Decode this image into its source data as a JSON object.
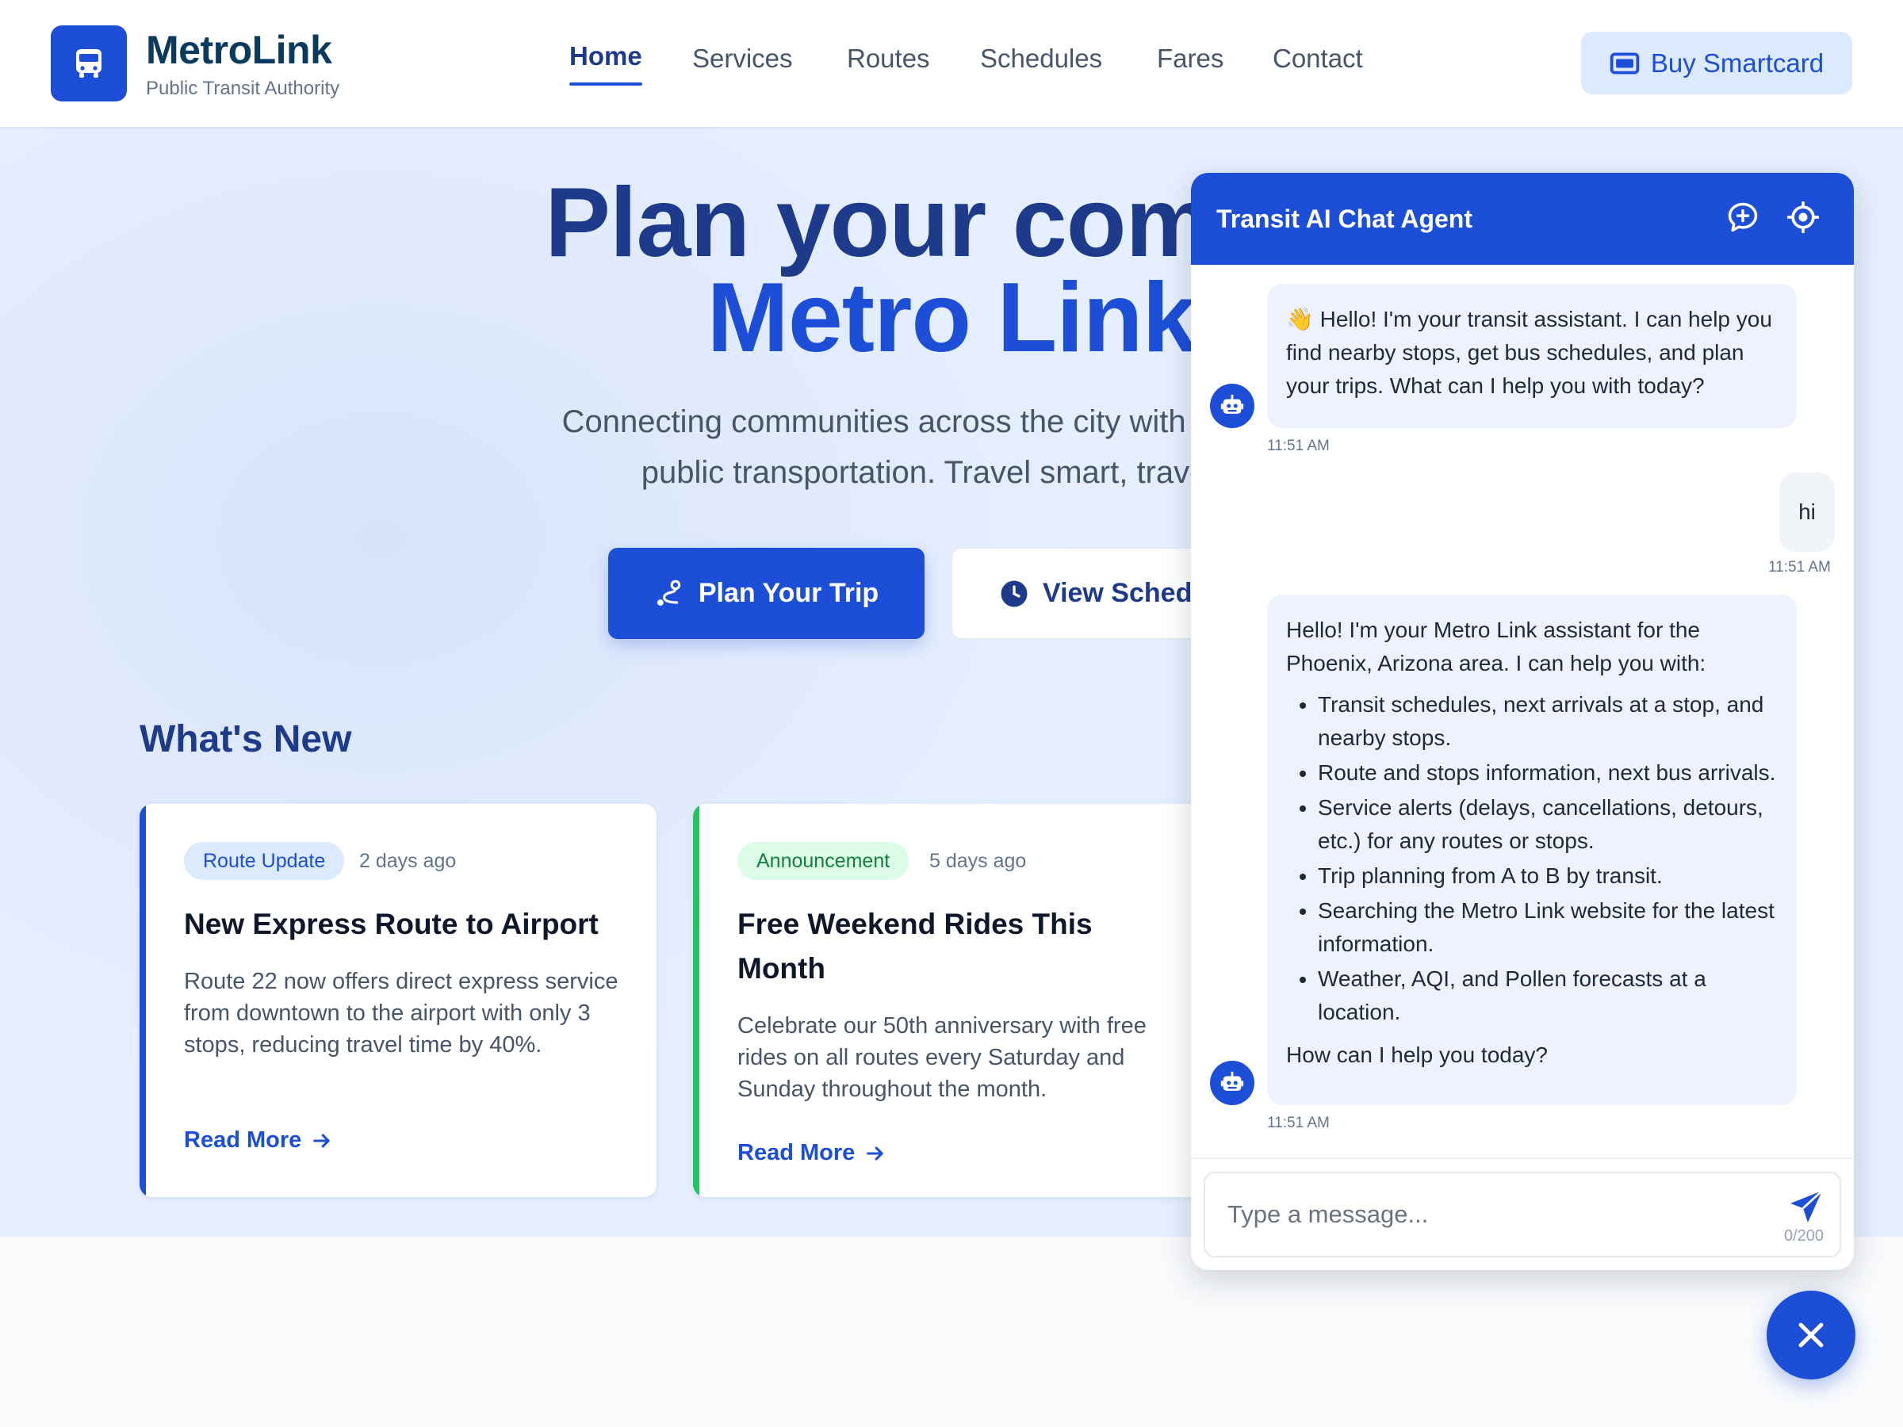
{
  "header": {
    "brand": "MetroLink",
    "tagline": "Public Transit Authority",
    "nav": [
      "Home",
      "Services",
      "Routes",
      "Schedules",
      "Fares",
      "Contact"
    ],
    "active_nav": "Home",
    "buy_button": "Buy Smartcard"
  },
  "hero": {
    "title_line1": "Plan your commu",
    "title_line2": "Metro Link",
    "subtitle_line1": "Connecting communities across the city with reliable, ef",
    "subtitle_line2": "public transportation. Travel smart, travel wit",
    "primary_button": "Plan Your Trip",
    "secondary_button": "View Sched"
  },
  "whats_new": {
    "heading": "What's New",
    "cards": [
      {
        "badge": "Route Update",
        "time": "2 days ago",
        "title": "New Express Route to Airport",
        "body": "Route 22 now offers direct express service from downtown to the airport with only 3 stops, reducing travel time by 40%.",
        "link": "Read More"
      },
      {
        "badge": "Announcement",
        "time": "5 days ago",
        "title": "Free Weekend Rides This Month",
        "body": "Celebrate our 50th anniversary with free rides on all routes every Saturday and Sunday throughout the month.",
        "link": "Read More"
      }
    ]
  },
  "chat": {
    "title": "Transit AI Chat Agent",
    "messages": [
      {
        "role": "bot",
        "text": "👋 Hello! I'm your transit assistant. I can help you find nearby stops, get bus schedules, and plan your trips. What can I help you with today?",
        "time": "11:51 AM"
      },
      {
        "role": "user",
        "text": "hi",
        "time": "11:51 AM"
      },
      {
        "role": "bot",
        "intro": "Hello! I'm your Metro Link assistant for the Phoenix, Arizona area. I can help you with:",
        "items": [
          "Transit schedules, next arrivals at a stop, and nearby stops.",
          "Route and stops information, next bus arrivals.",
          "Service alerts (delays, cancellations, detours, etc.) for any routes or stops.",
          "Trip planning from A to B by transit.",
          "Searching the Metro Link website for the latest information.",
          "Weather, AQI, and Pollen forecasts at a location."
        ],
        "outro": "How can I help you today?",
        "time": "11:51 AM"
      }
    ],
    "input_placeholder": "Type a message...",
    "char_count": "0/200"
  },
  "colors": {
    "primary": "#1d4ed8",
    "navy": "#1e3a8a",
    "success": "#22c55e"
  },
  "icons": [
    "bus-icon",
    "card-icon",
    "route-icon",
    "clock-icon",
    "arrow-right-icon",
    "chat-plus-icon",
    "locate-icon",
    "robot-icon",
    "send-icon",
    "close-icon"
  ]
}
